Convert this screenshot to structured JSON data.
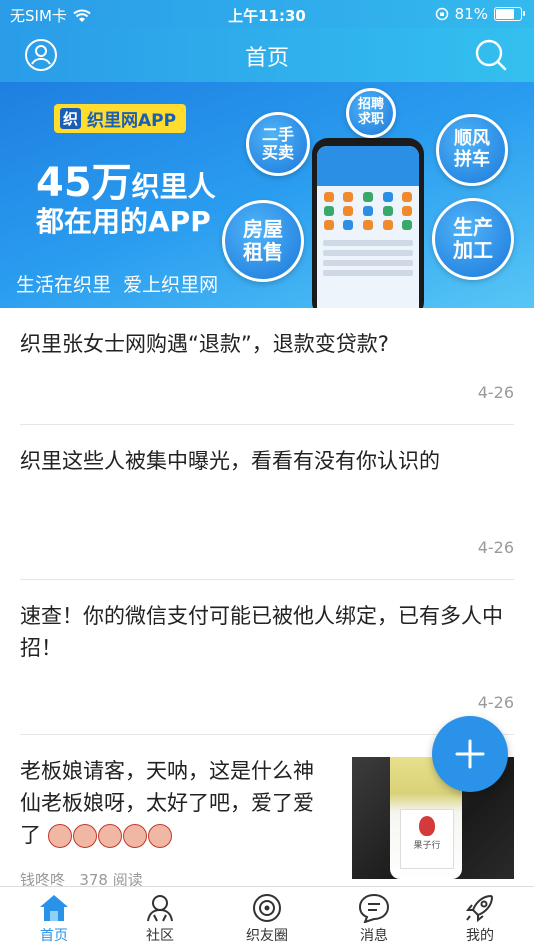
{
  "status_bar": {
    "carrier": "无SIM卡",
    "time": "上午11:30",
    "battery": "81%",
    "battery_level": 0.81
  },
  "nav": {
    "title": "首页",
    "left_icon": "user-icon",
    "right_icon": "search-icon"
  },
  "banner": {
    "app_name": "织里网APP",
    "logo_char": "织",
    "line1_big": "45万",
    "line1_rest": "织里人",
    "line2": "都在用的APP",
    "slogan": "生活在织里  爱上织里网",
    "bubbles": [
      "招聘\n求职",
      "二手\n买卖",
      "顺风\n拼车",
      "房屋\n租售",
      "生产\n加工"
    ]
  },
  "feed": [
    {
      "title": "织里张女士网购遇“退款”，退款变贷款?",
      "date": "4-26"
    },
    {
      "title": "织里这些人被集中曝光，看看有没有你认识的",
      "date": "4-26"
    },
    {
      "title": "速查！你的微信支付可能已被他人绑定，已有多人中招！",
      "date": "4-26"
    },
    {
      "title": "老板娘请客，天呐，这是什么神仙老板娘呀，太好了吧，爱了爱了",
      "author": "钱咚咚",
      "reads": "378 阅读",
      "thumb_label": "果子行"
    }
  ],
  "fab": {
    "icon": "plus-icon"
  },
  "tabs": [
    {
      "label": "首页",
      "icon": "home-icon",
      "active": true
    },
    {
      "label": "社区",
      "icon": "community-icon",
      "active": false
    },
    {
      "label": "织友圈",
      "icon": "friends-circle-icon",
      "active": false
    },
    {
      "label": "消息",
      "icon": "message-icon",
      "active": false
    },
    {
      "label": "我的",
      "icon": "rocket-icon",
      "active": false
    }
  ],
  "colors": {
    "primary": "#2a92e8",
    "banner_yellow": "#ffdc2e"
  }
}
